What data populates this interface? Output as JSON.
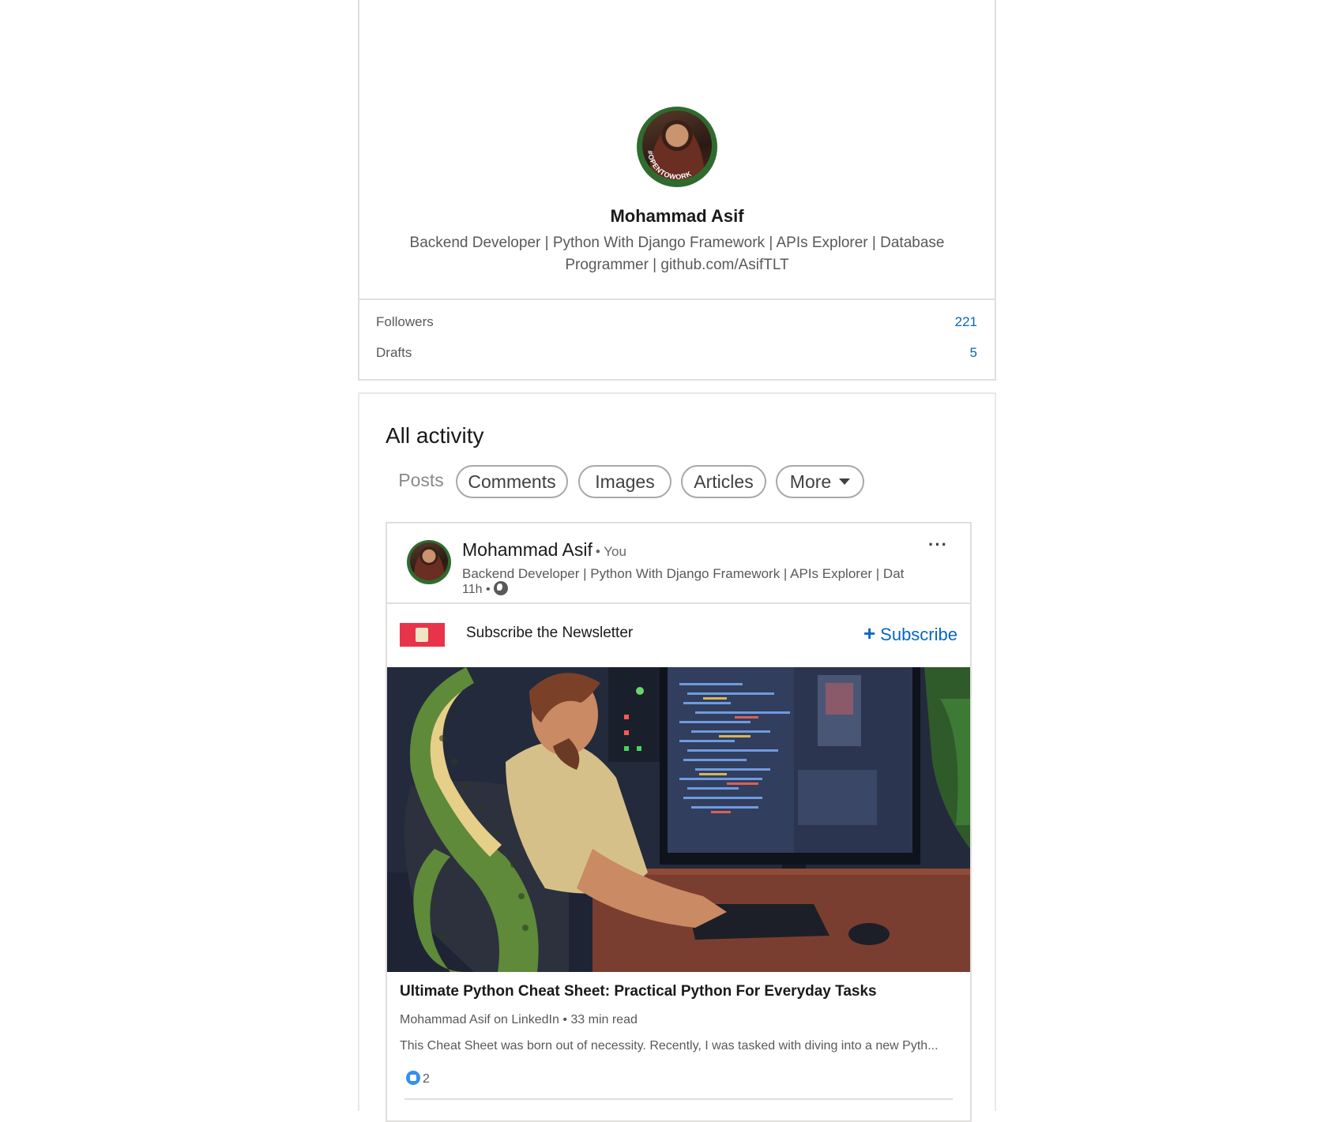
{
  "profile": {
    "name": "Mohammad Asif",
    "headline": "Backend Developer | Python With Django Framework | APIs Explorer | Database Programmer | github.com/AsifTLT",
    "avatar_badge": "#OPENTOWORK",
    "stats": [
      {
        "label": "Followers",
        "value": "221"
      },
      {
        "label": "Drafts",
        "value": "5"
      }
    ]
  },
  "activity": {
    "title": "All activity",
    "filters": [
      "Posts",
      "Comments",
      "Images",
      "Articles",
      "More"
    ],
    "post": {
      "author": "Mohammad Asif",
      "relation": "• You",
      "headline": "Backend Developer | Python With Django Framework | APIs Explorer | Dat...",
      "time": "11h •",
      "newsletter_label": "Subscribe the Newsletter",
      "subscribe_label": "Subscribe",
      "article_title": "Ultimate Python Cheat Sheet: Practical Python For Everyday Tasks",
      "article_meta": "Mohammad Asif on LinkedIn • 33 min read",
      "article_snippet": "This Cheat Sheet was born out of necessity. Recently, I was tasked with diving into a new Pyth...",
      "reaction_count": "2"
    }
  },
  "colors": {
    "accent": "#0a66c2",
    "open_to_work": "#2f6b2f",
    "border": "#e0dfdc"
  }
}
